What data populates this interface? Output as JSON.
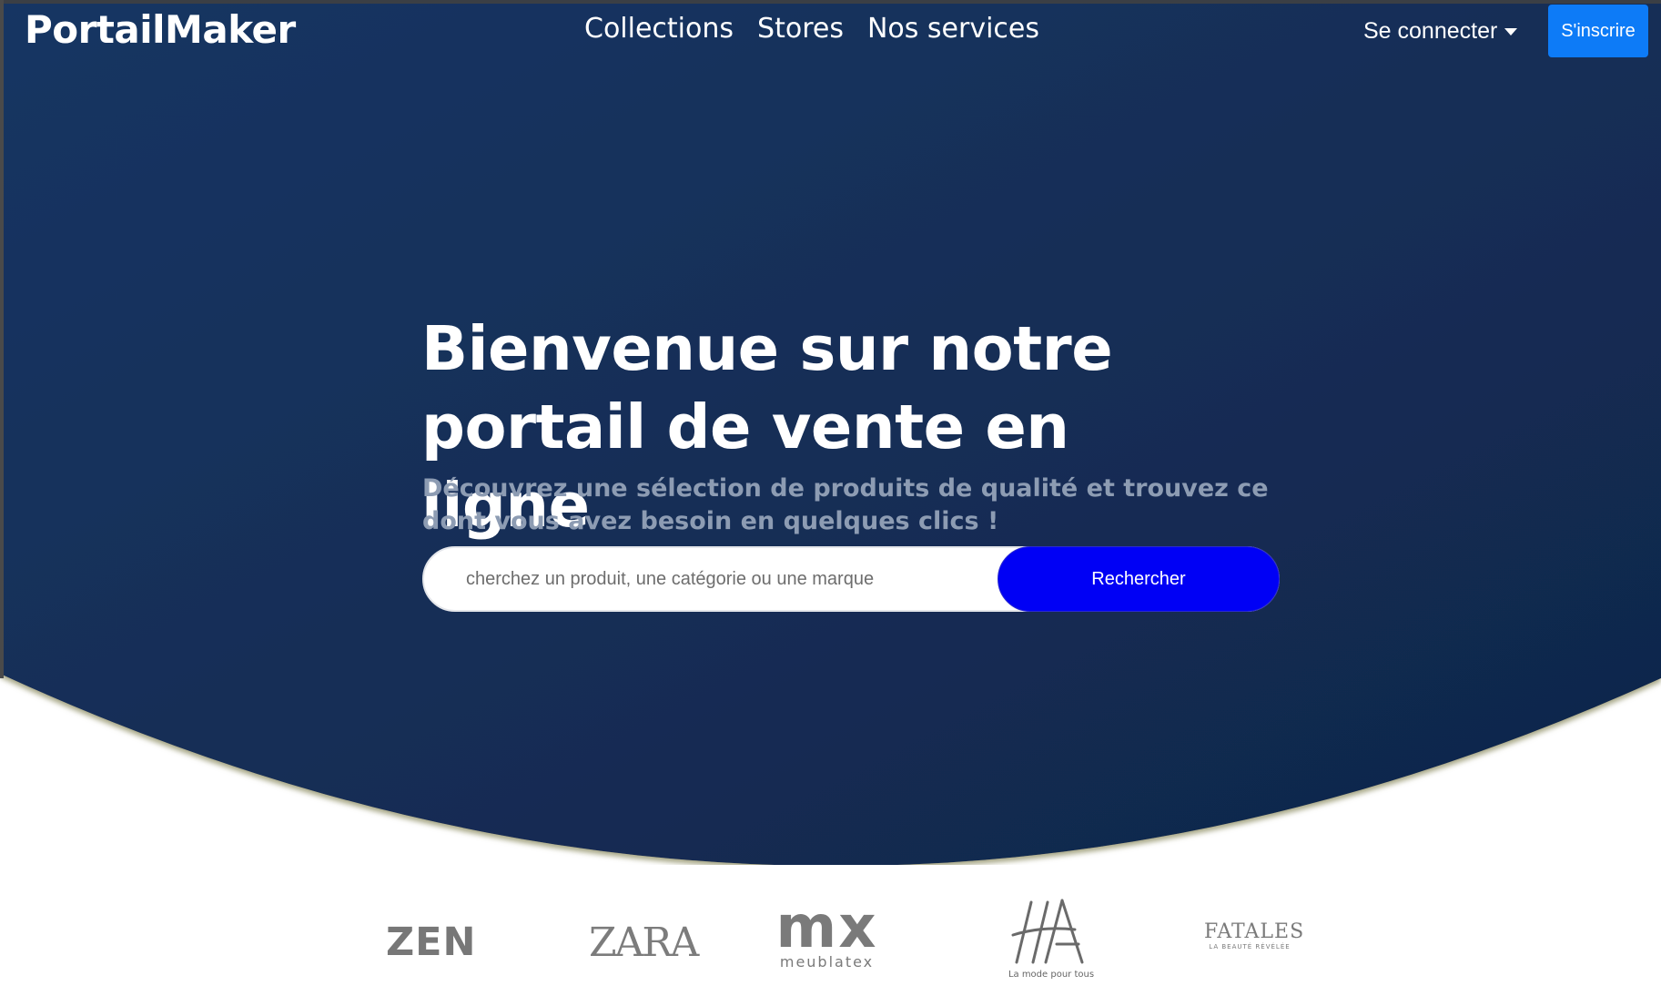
{
  "navbar": {
    "brand": "PortailMaker",
    "links": [
      "Collections",
      "Stores",
      "Nos services"
    ],
    "login_label": "Se connecter",
    "signup_label": "S'inscrire"
  },
  "hero": {
    "title_line1": "Bienvenue sur notre",
    "title_line2": "portail de vente en ligne",
    "subtitle": "Découvrez une sélection de produits de qualité et trouvez ce dont vous avez besoin en quelques clics !",
    "search": {
      "placeholder": "cherchez un produit, une catégorie ou une marque",
      "value": "",
      "button_label": "Rechercher"
    }
  },
  "brands": {
    "zen": "ZEN",
    "zara": "ZARA",
    "mx": "mx",
    "mx_sub": "meublatex",
    "ha_sub": "La mode pour tous",
    "fatales": "FATALES",
    "fatales_sub": "LA BEAUTÉ RÉVÉLÉE"
  },
  "colors": {
    "hero_background": "#132d55",
    "signup_button": "#0d7bf7",
    "search_button": "#0000f5",
    "subtitle": "#8d9cb3"
  },
  "icons": {
    "login_dropdown": "caret-down-icon"
  }
}
